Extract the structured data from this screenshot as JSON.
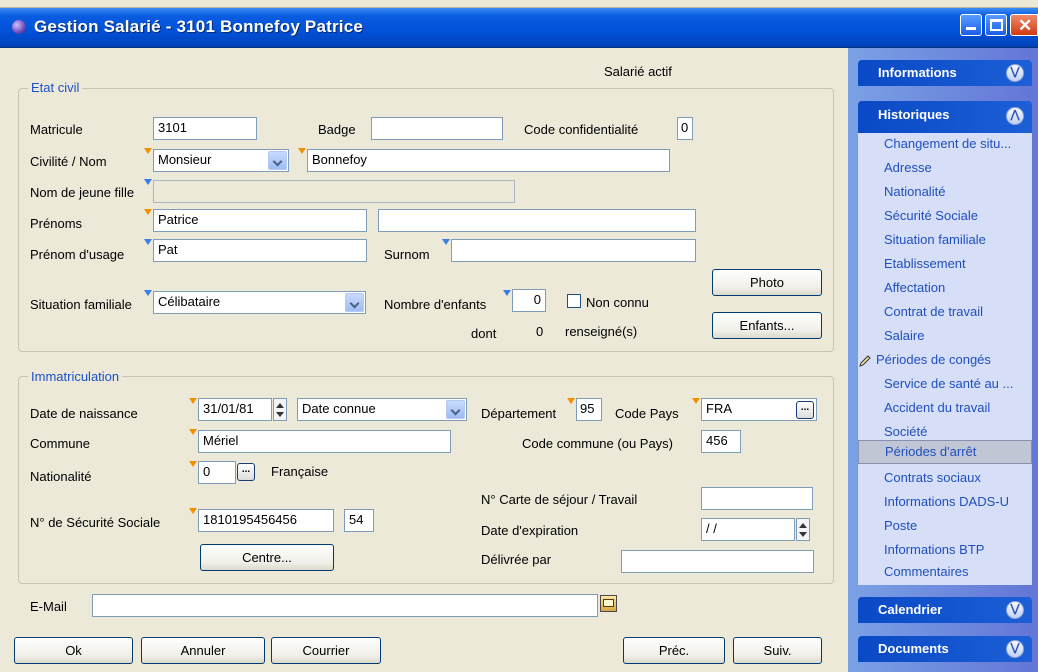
{
  "window": {
    "title": "Gestion Salarié - 3101 Bonnefoy Patrice"
  },
  "status": "Salarié actif",
  "etat_civil": {
    "legend": "Etat civil",
    "matricule_label": "Matricule",
    "matricule": "3101",
    "badge_label": "Badge",
    "badge": "",
    "code_conf_label": "Code confidentialité",
    "code_conf": "0",
    "civilite_label": "Civilité /  Nom",
    "civilite": "Monsieur",
    "nom": "Bonnefoy",
    "jeune_fille_label": "Nom de jeune fille",
    "jeune_fille": "",
    "prenoms_label": "Prénoms",
    "prenom1": "Patrice",
    "prenom2": "",
    "prenom_usage_label": "Prénom d'usage",
    "prenom_usage": "Pat",
    "surnom_label": "Surnom",
    "surnom": "",
    "photo_button": "Photo",
    "situation_label": "Situation familiale",
    "situation": "Célibataire",
    "nb_enfants_label": "Nombre d'enfants",
    "nb_enfants": "0",
    "non_connu_label": "Non connu",
    "dont_label": "dont",
    "dont_value": "0",
    "renseignes_label": "renseigné(s)",
    "enfants_button": "Enfants..."
  },
  "immatriculation": {
    "legend": "Immatriculation",
    "naissance_label": "Date de naissance",
    "naissance": "31/01/81",
    "date_type": "Date connue",
    "departement_label": "Département",
    "departement": "95",
    "code_pays_label": "Code Pays",
    "code_pays": "FRA",
    "commune_label": "Commune",
    "commune": "Mériel",
    "code_commune_label": "Code commune (ou Pays)",
    "code_commune": "456",
    "nationalite_label": "Nationalité",
    "nationalite_code": "0",
    "nationalite_text": "Française",
    "carte_label": "N° Carte de séjour / Travail",
    "carte": "",
    "secu_label": "N° de Sécurité Sociale",
    "secu": "1810195456456",
    "secu_cle": "54",
    "expiration_label": "Date d'expiration",
    "expiration": " / /",
    "centre_button": "Centre...",
    "delivree_label": "Délivrée par",
    "delivree": ""
  },
  "email": {
    "label": "E-Mail",
    "value": ""
  },
  "buttons": {
    "ok": "Ok",
    "annuler": "Annuler",
    "courrier": "Courrier",
    "prec": "Préc.",
    "suiv": "Suiv."
  },
  "sidebar": {
    "informations": "Informations",
    "historiques": "Historiques",
    "calendrier": "Calendrier",
    "documents": "Documents",
    "items": [
      "Changement de situ...",
      "Adresse",
      "Nationalité",
      "Sécurité Sociale",
      "Situation familiale",
      "Etablissement",
      "Affectation",
      "Contrat de travail",
      "Salaire",
      "Périodes de congés",
      "Service de santé au ...",
      "Accident du travail",
      "Société",
      "Périodes d'arrêt",
      "Contrats sociaux",
      "Informations DADS-U",
      "Poste",
      " Informations BTP",
      "Commentaires"
    ],
    "selected_index": 13
  },
  "colors": {
    "title_bar": "#0050d8",
    "legend": "#1c50c8",
    "sidebar_link": "#1f4fc0",
    "required_marker": "#f09000"
  }
}
